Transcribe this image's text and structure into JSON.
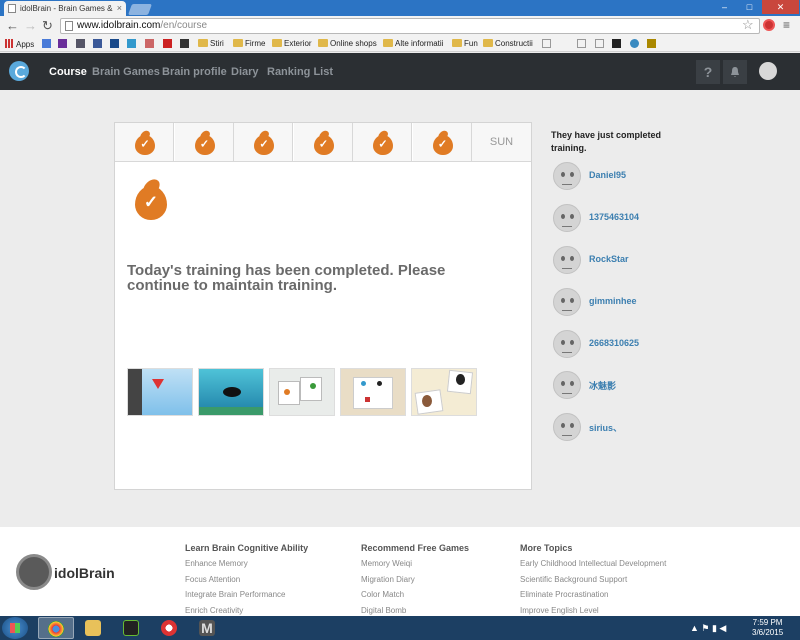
{
  "browser": {
    "tab_title": "idolBrain - Brain Games &",
    "url_host": "www.idolbrain.com",
    "url_path": "/en/course",
    "window_controls": {
      "minimize": "–",
      "maximize": "□",
      "close": "✕"
    }
  },
  "bookmarks": [
    {
      "label": "Apps",
      "icon": "apps-icon"
    },
    {
      "label": "Stiri",
      "icon": "folder-icon"
    },
    {
      "label": "Firme",
      "icon": "folder-icon"
    },
    {
      "label": "Exterior",
      "icon": "folder-icon"
    },
    {
      "label": "Online shops",
      "icon": "folder-icon"
    },
    {
      "label": "Alte informatii",
      "icon": "folder-icon"
    },
    {
      "label": "Fun",
      "icon": "folder-icon"
    },
    {
      "label": "Constructii",
      "icon": "folder-icon"
    }
  ],
  "site_nav": {
    "items": [
      "Course",
      "Brain Games",
      "Brain profile",
      "Diary",
      "Ranking List"
    ],
    "active": "Course",
    "help_label": "?"
  },
  "week": {
    "completed_days": 6,
    "last_label": "SUN"
  },
  "main": {
    "message": "Today's training has been completed. Please continue to maintain training.",
    "games": [
      "game-thumb-1",
      "game-thumb-2",
      "game-thumb-3",
      "game-thumb-4",
      "game-thumb-5"
    ]
  },
  "side": {
    "title": "They have just completed training.",
    "users": [
      "Daniel95",
      "1375463104",
      "RockStar",
      "gimminhee",
      "2668310625",
      "冰魅影",
      "sirius、"
    ]
  },
  "footer": {
    "logo_text": "idolBrain",
    "columns": [
      {
        "heading": "Learn Brain Cognitive Ability",
        "links": [
          "Enhance Memory",
          "Focus Attention",
          "Integrate Brain Performance",
          "Enrich Creativity"
        ]
      },
      {
        "heading": "Recommend Free Games",
        "links": [
          "Memory Weiqi",
          "Migration Diary",
          "Color Match",
          "Digital Bomb"
        ]
      },
      {
        "heading": "More Topics",
        "links": [
          "Early Childhood Intellectual Development",
          "Scientific Background Support",
          "Eliminate Procrastination",
          "Improve English Level"
        ]
      }
    ]
  },
  "taskbar": {
    "time": "7:59 PM",
    "date": "3/6/2015"
  },
  "colors": {
    "accent": "#e07b24",
    "header_bg": "#2b2f33",
    "link": "#3c7fb0"
  }
}
